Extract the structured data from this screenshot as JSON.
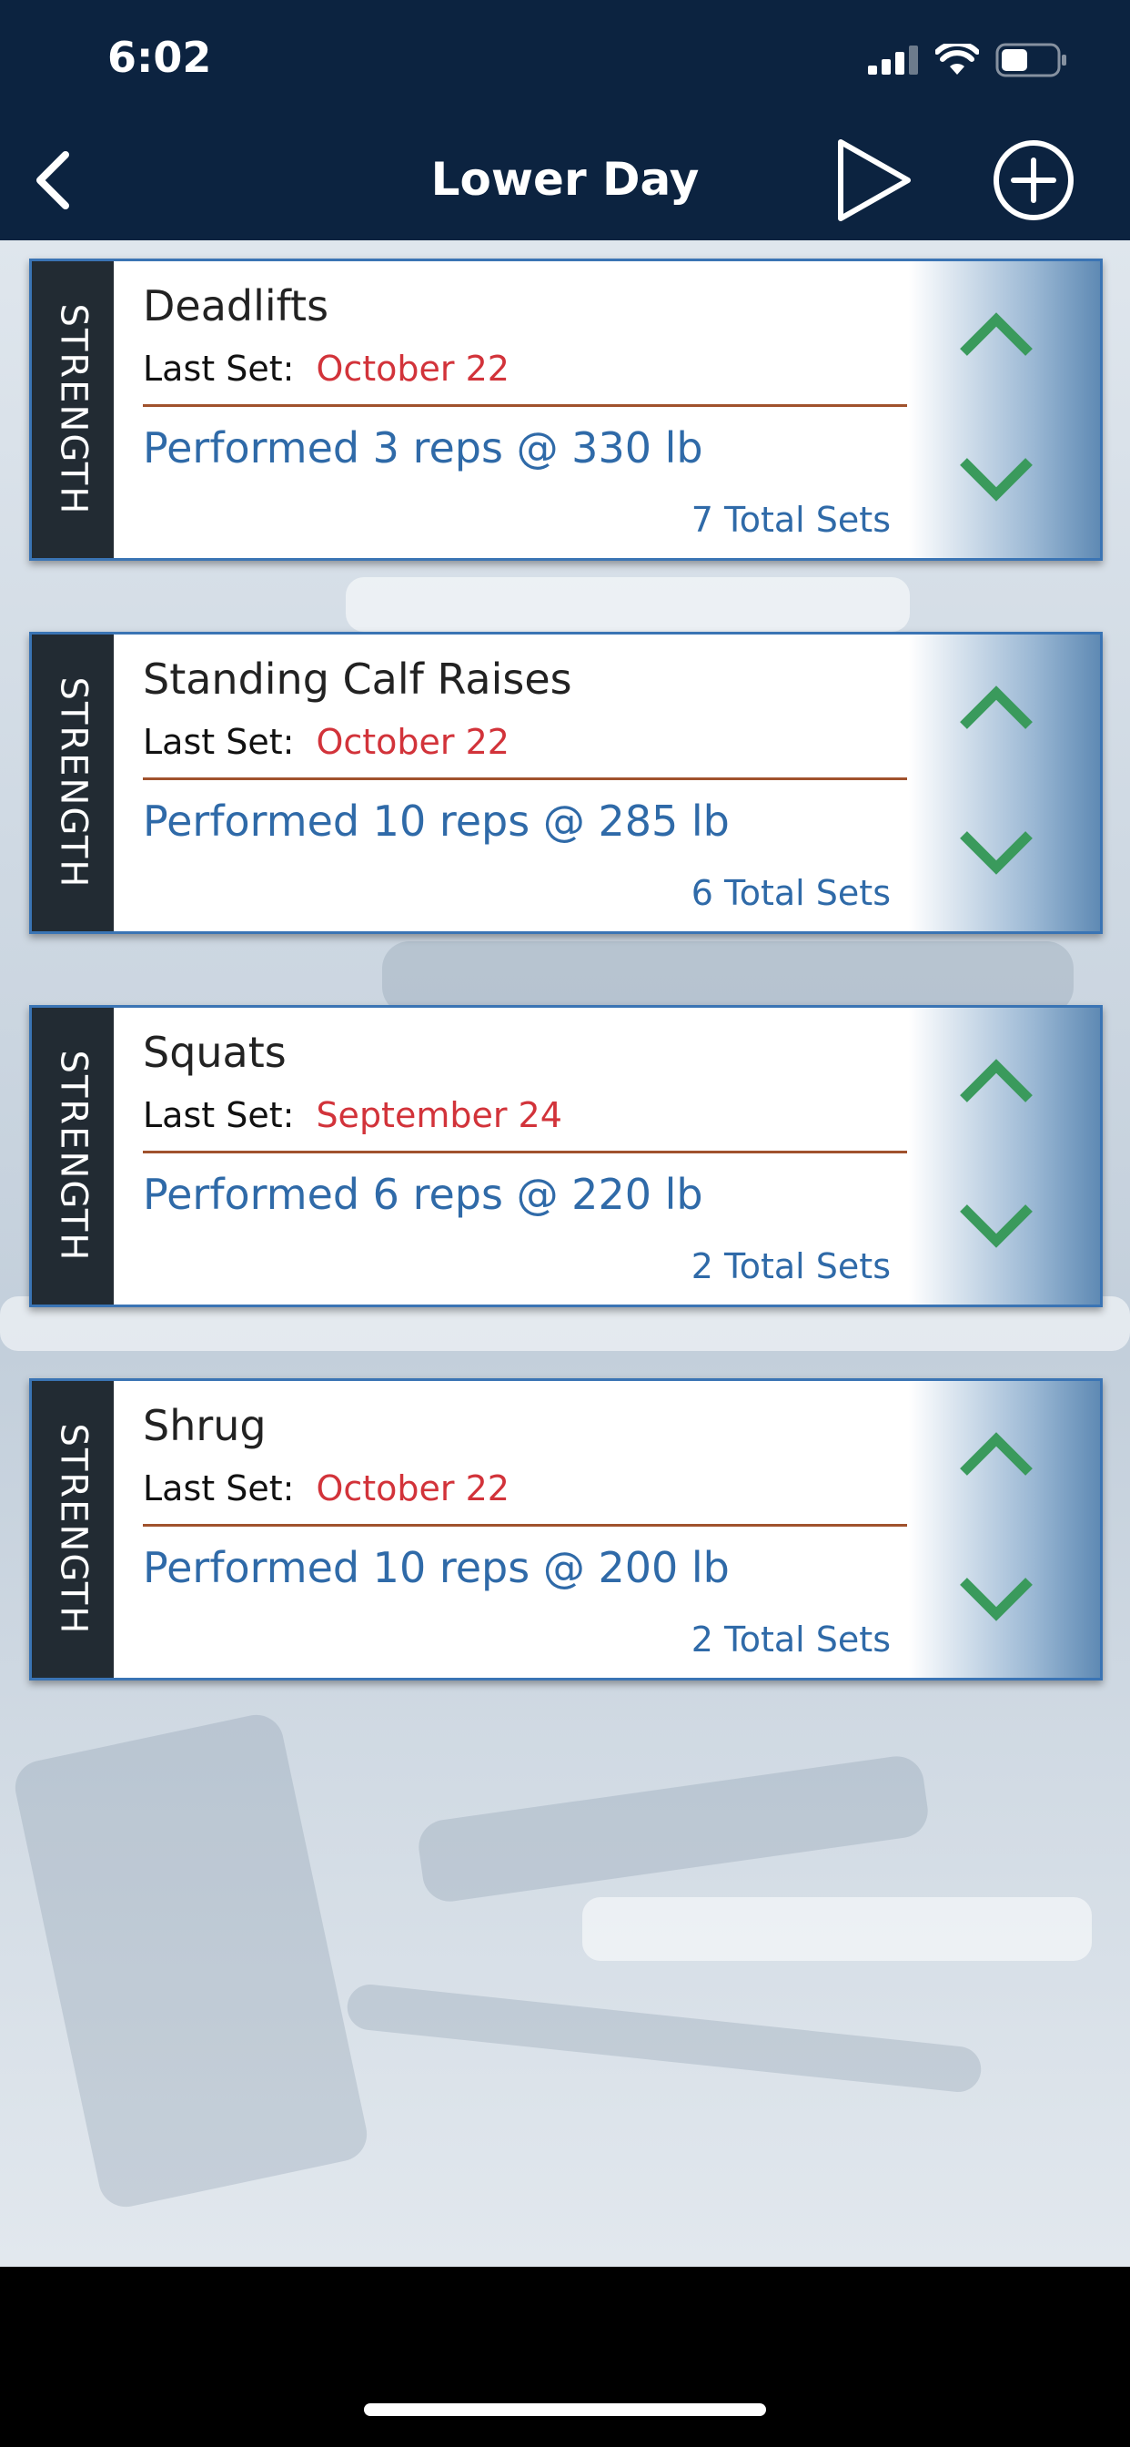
{
  "status_bar": {
    "time": "6:02"
  },
  "nav": {
    "title": "Lower Day"
  },
  "exercises": [
    {
      "type": "STRENGTH",
      "name": "Deadlifts",
      "last_set_label": "Last Set:",
      "last_set_date": "October 22",
      "performed": "Performed 3 reps @ 330 lb",
      "total_sets": "7 Total Sets"
    },
    {
      "type": "STRENGTH",
      "name": "Standing Calf Raises",
      "last_set_label": "Last Set:",
      "last_set_date": "October 22",
      "performed": "Performed 10 reps @ 285 lb",
      "total_sets": "6 Total Sets"
    },
    {
      "type": "STRENGTH",
      "name": "Squats",
      "last_set_label": "Last Set:",
      "last_set_date": "September 24",
      "performed": "Performed 6 reps @ 220 lb",
      "total_sets": "2 Total Sets"
    },
    {
      "type": "STRENGTH",
      "name": "Shrug",
      "last_set_label": "Last Set:",
      "last_set_date": "October 22",
      "performed": "Performed 10 reps @ 200 lb",
      "total_sets": "2 Total Sets"
    }
  ],
  "colors": {
    "nav_bg": "#0c2340",
    "accent_blue": "#2f6aa8",
    "date_red": "#d2333a",
    "arrow_green": "#3a9a5c",
    "tag_bg": "#222b33"
  },
  "icons": {
    "back": "chevron-left-icon",
    "play": "play-icon",
    "add": "plus-circle-icon",
    "move_up": "chevron-up-icon",
    "move_down": "chevron-down-icon"
  }
}
